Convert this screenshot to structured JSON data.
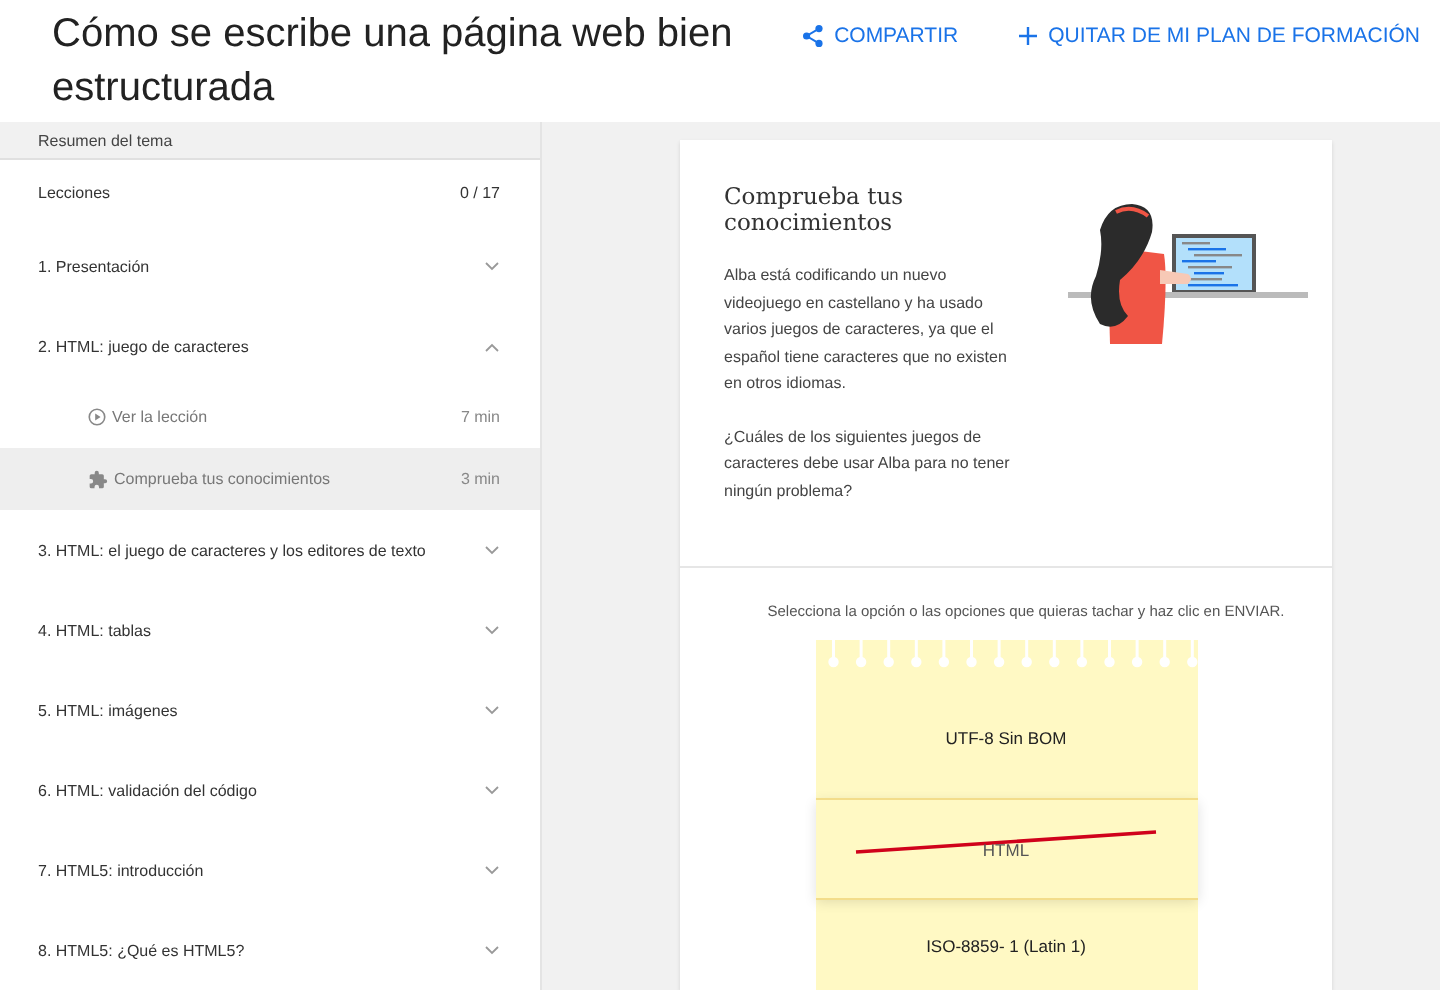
{
  "header": {
    "title": "Cómo se escribe una página web bien estructurada",
    "actions": [
      {
        "kind": "share",
        "label": "COMPARTIR"
      },
      {
        "kind": "remove",
        "label": "QUITAR DE MI PLAN DE FORMACIÓN"
      }
    ]
  },
  "sidebar": {
    "heading": "Resumen del tema",
    "lessons_label": "Lecciones",
    "progress": "0 / 17",
    "topics": [
      {
        "title": "1. Presentación",
        "expanded": false
      },
      {
        "title": "2. HTML: juego de caracteres",
        "expanded": true,
        "children": [
          {
            "kind": "video",
            "title": "Ver la lección",
            "duration": "7 min",
            "selected": false
          },
          {
            "kind": "quiz",
            "title": "Comprueba tus conocimientos",
            "duration": "3 min",
            "selected": true
          }
        ]
      },
      {
        "title": "3. HTML: el juego de caracteres y los editores de texto",
        "expanded": false
      },
      {
        "title": "4. HTML: tablas",
        "expanded": false
      },
      {
        "title": "5. HTML: imágenes",
        "expanded": false
      },
      {
        "title": "6. HTML: validación del código",
        "expanded": false
      },
      {
        "title": "7. HTML5: introducción",
        "expanded": false
      },
      {
        "title": "8. HTML5: ¿Qué es HTML5?",
        "expanded": false
      }
    ]
  },
  "quiz": {
    "title": "Comprueba tus conocimientos",
    "paragraphs": [
      "Alba está codificando un nuevo videojuego en castellano y ha usado varios juegos de caracteres, ya que el español tiene caracteres que no existen en otros idiomas.",
      "¿Cuáles de los siguientes juegos de caracteres debe usar Alba para no tener ningún problema?"
    ],
    "instruction": "Selecciona la opción o las opciones que quieras tachar y haz clic en ENVIAR.",
    "options": [
      {
        "label": "UTF-8 Sin BOM",
        "crossed": false
      },
      {
        "label": "HTML",
        "crossed": true
      },
      {
        "label": "ISO-8859- 1 (Latin 1)",
        "crossed": false
      }
    ]
  }
}
